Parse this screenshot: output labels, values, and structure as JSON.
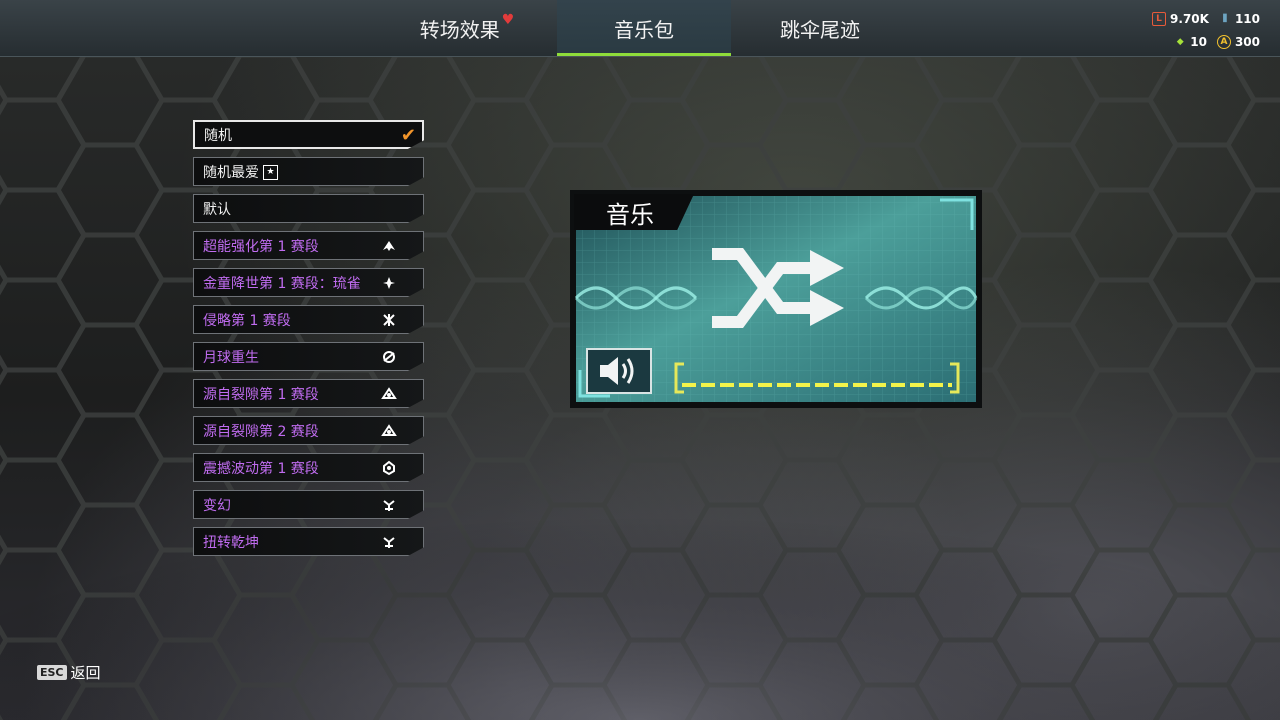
{
  "tabs": [
    {
      "label": "转场效果",
      "badge": "♥",
      "active": false
    },
    {
      "label": "音乐包",
      "active": true
    },
    {
      "label": "跳伞尾迹",
      "active": false
    }
  ],
  "currency": {
    "legend_tokens": "9.70K",
    "apex_coins": "110",
    "crafting_metals": "10",
    "gold_tokens": "300"
  },
  "music_list": {
    "items": [
      {
        "label": "随机",
        "color": "white",
        "selected": true,
        "icon": "checkmark-icon"
      },
      {
        "label": "随机最爱",
        "color": "white",
        "icon": "favorite-star-icon"
      },
      {
        "label": "默认",
        "color": "white"
      },
      {
        "label": "超能强化第 1 赛段",
        "color": "purple",
        "icon": "event-badge-icon"
      },
      {
        "label": "金童降世第 1 赛段：琉雀",
        "color": "purple",
        "icon": "event-badge-icon"
      },
      {
        "label": "侵略第 1 赛段",
        "color": "purple",
        "icon": "event-badge-icon"
      },
      {
        "label": "月球重生",
        "color": "purple",
        "icon": "event-badge-icon"
      },
      {
        "label": "源自裂隙第 1 赛段",
        "color": "purple",
        "icon": "event-badge-icon"
      },
      {
        "label": "源自裂隙第 2 赛段",
        "color": "purple",
        "icon": "event-badge-icon"
      },
      {
        "label": "震撼波动第 1 赛段",
        "color": "purple",
        "icon": "event-badge-icon"
      },
      {
        "label": "变幻",
        "color": "purple",
        "icon": "event-badge-icon"
      },
      {
        "label": "扭转乾坤",
        "color": "purple",
        "icon": "event-badge-icon"
      }
    ]
  },
  "preview": {
    "title": "音乐",
    "main_icon": "shuffle-icon",
    "volume_icon": "speaker-icon"
  },
  "footer": {
    "esc_key": "ESC",
    "back_label": "返回"
  },
  "colors": {
    "accent_green": "#8fdc3a",
    "selected_check": "#f2952b",
    "purple_text": "#c06cf0",
    "panel_teal": "#3b8e8a",
    "volume_yellow": "#f3f34a"
  }
}
